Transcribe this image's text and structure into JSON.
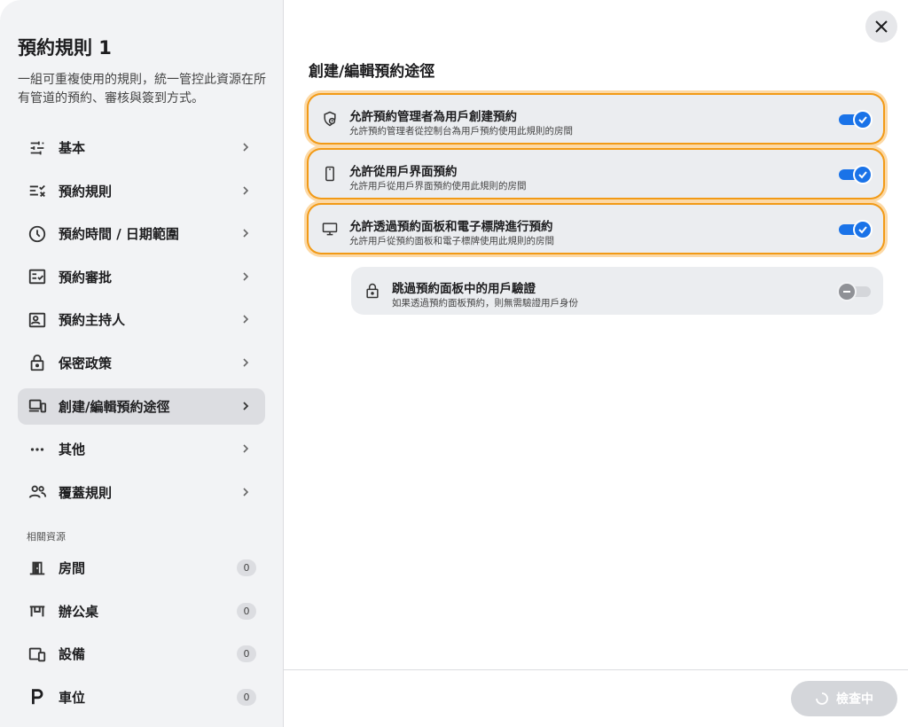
{
  "sidebar": {
    "title": "預約規則 1",
    "description": "一組可重複使用的規則，統一管控此資源在所有管道的預約、審核與簽到方式。",
    "items": [
      {
        "label": "基本",
        "icon": "sliders-icon"
      },
      {
        "label": "預約規則",
        "icon": "checklist-icon"
      },
      {
        "label": "預約時間 / 日期範圍",
        "icon": "clock-icon"
      },
      {
        "label": "預約審批",
        "icon": "approval-icon"
      },
      {
        "label": "預約主持人",
        "icon": "host-icon"
      },
      {
        "label": "保密政策",
        "icon": "lock-icon"
      },
      {
        "label": "創建/編輯預約途徑",
        "icon": "devices-icon",
        "active": true
      },
      {
        "label": "其他",
        "icon": "more-icon"
      },
      {
        "label": "覆蓋規則",
        "icon": "people-icon"
      }
    ],
    "resources_label": "相關資源",
    "resources": [
      {
        "label": "房間",
        "count": "0",
        "icon": "door-icon"
      },
      {
        "label": "辦公桌",
        "count": "0",
        "icon": "desk-icon"
      },
      {
        "label": "設備",
        "count": "0",
        "icon": "equipment-icon"
      },
      {
        "label": "車位",
        "count": "0",
        "icon": "parking-icon"
      }
    ]
  },
  "main": {
    "title": "創建/編輯預約途徑",
    "options": [
      {
        "title": "允許預約管理者為用戶創建預約",
        "subtitle": "允許預約管理者從控制台為用戶預約使用此規則的房間",
        "enabled": true,
        "icon": "shield-icon"
      },
      {
        "title": "允許從用戶界面預約",
        "subtitle": "允許用戶從用戶界面預約使用此規則的房間",
        "enabled": true,
        "icon": "phone-icon"
      },
      {
        "title": "允許透過預約面板和電子標牌進行預約",
        "subtitle": "允許用戶從預約面板和電子標牌使用此規則的房間",
        "enabled": true,
        "icon": "monitor-icon"
      },
      {
        "title": "跳過預約面板中的用戶驗證",
        "subtitle": "如果透過預約面板預約，則無需驗證用戶身份",
        "enabled": false,
        "icon": "lock-icon"
      }
    ]
  },
  "footer": {
    "check_label": "檢查中"
  },
  "colors": {
    "accent": "#1a73e8",
    "highlight": "#f29a16"
  }
}
